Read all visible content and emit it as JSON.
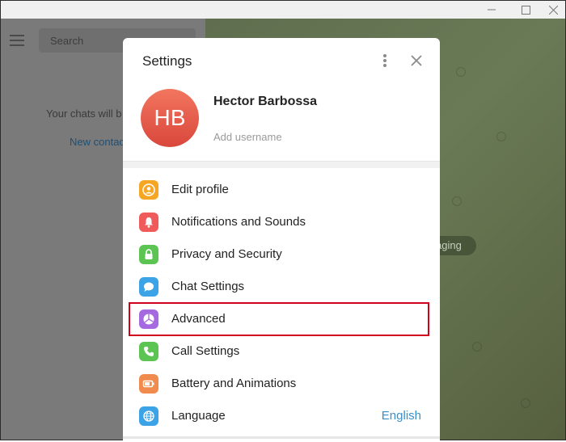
{
  "window": {
    "maximize_icon": "maximize-icon",
    "close_icon": "close-icon"
  },
  "sidebar": {
    "search_placeholder": "Search",
    "empty_text": "Your chats will b",
    "new_contact_link": "New contac"
  },
  "chat": {
    "pill_text": "aging"
  },
  "settings": {
    "title": "Settings",
    "profile": {
      "initials": "HB",
      "name": "Hector Barbossa",
      "username_placeholder": "Add username"
    },
    "items": [
      {
        "label": "Edit profile",
        "icon": "person-icon",
        "color": "#f5a623"
      },
      {
        "label": "Notifications and Sounds",
        "icon": "bell-icon",
        "color": "#ef5b5b"
      },
      {
        "label": "Privacy and Security",
        "icon": "lock-icon",
        "color": "#5cc452"
      },
      {
        "label": "Chat Settings",
        "icon": "chat-bubble-icon",
        "color": "#3ba3e6"
      },
      {
        "label": "Advanced",
        "icon": "pie-chart-icon",
        "color": "#a66ae0"
      },
      {
        "label": "Call Settings",
        "icon": "phone-icon",
        "color": "#5cc452"
      },
      {
        "label": "Battery and Animations",
        "icon": "battery-icon",
        "color": "#f08b4d"
      },
      {
        "label": "Language",
        "icon": "globe-icon",
        "color": "#3ba3e6",
        "value": "English"
      }
    ],
    "highlighted_item": "Advanced",
    "highlight_color": "#d0021b"
  }
}
